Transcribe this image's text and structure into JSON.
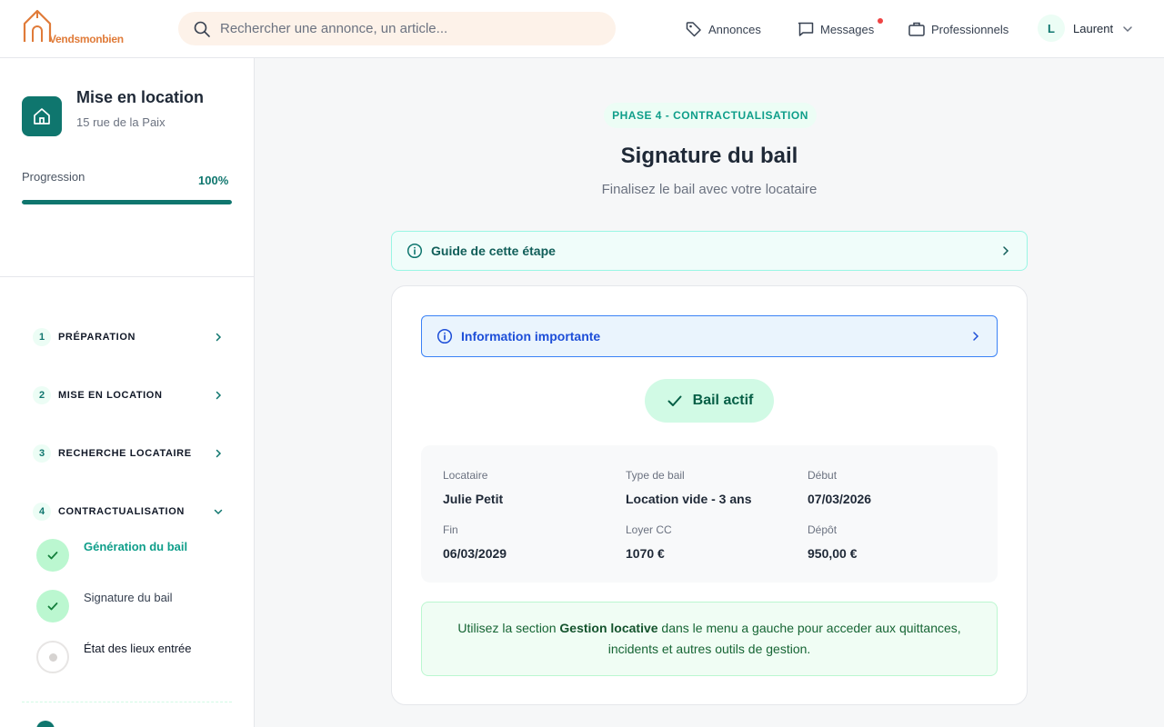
{
  "header": {
    "logo_text": "Vendsmonbien",
    "search_placeholder": "Rechercher une annonce, un article...",
    "nav": [
      {
        "label": "Annonces",
        "icon": "tag-icon"
      },
      {
        "label": "Messages",
        "icon": "message-icon",
        "has_notification": true
      },
      {
        "label": "Professionnels",
        "icon": "briefcase-icon"
      }
    ],
    "user": {
      "initial": "L",
      "name": "Laurent"
    }
  },
  "sidebar": {
    "project_title": "Mise en location",
    "project_address": "15 rue de la Paix",
    "progress_label": "Progression",
    "progress_value": "100%",
    "progress_fraction": 1.0,
    "phases": [
      {
        "num": "1",
        "label": "PRÉPARATION",
        "expanded": false
      },
      {
        "num": "2",
        "label": "MISE EN LOCATION",
        "expanded": false
      },
      {
        "num": "3",
        "label": "RECHERCHE LOCATAIRE",
        "expanded": false
      },
      {
        "num": "4",
        "label": "CONTRACTUALISATION",
        "expanded": true
      }
    ],
    "steps": [
      {
        "label": "Génération du bail",
        "status": "done",
        "active": true
      },
      {
        "label": "Signature du bail",
        "status": "done",
        "active": false
      },
      {
        "label": "État des lieux entrée",
        "status": "todo",
        "active": false
      }
    ]
  },
  "main": {
    "phase_pill": "PHASE 4 - CONTRACTUALISATION",
    "title": "Signature du bail",
    "subtitle": "Finalisez le bail avec votre locataire",
    "guide_label": "Guide de cette étape",
    "info_label": "Information importante",
    "badge_label": "Bail actif",
    "details": [
      {
        "key": "Locataire",
        "value": "Julie Petit"
      },
      {
        "key": "Type de bail",
        "value": "Location vide - 3 ans"
      },
      {
        "key": "Début",
        "value": "07/03/2026"
      },
      {
        "key": "Fin",
        "value": "06/03/2029"
      },
      {
        "key": "Loyer CC",
        "value": "1070 €"
      },
      {
        "key": "Dépôt",
        "value": "950,00 €"
      }
    ],
    "notice_before": "Utilisez la section ",
    "notice_strong": "Gestion locative",
    "notice_after": " dans le menu a gauche pour acceder aux quittances, incidents et autres outils de gestion."
  },
  "colors": {
    "brand_orange": "#e07b39",
    "accent_teal": "#0f766e",
    "info_blue": "#3b82f6",
    "success_green": "#d1fae5",
    "notification_red": "#ef4444"
  }
}
